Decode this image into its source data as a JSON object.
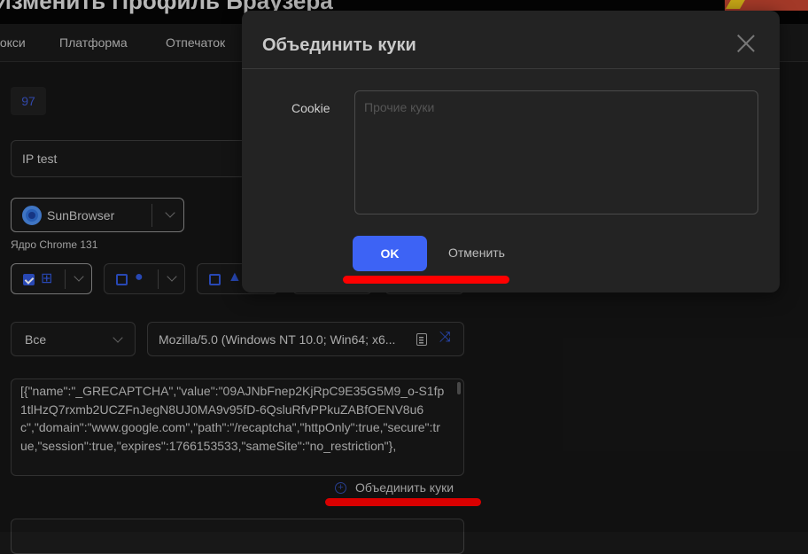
{
  "header": {
    "title": "Изменить Профиль Браузера"
  },
  "tabs": [
    "Прокси",
    "Платформа",
    "Отпечаток"
  ],
  "form": {
    "id_badge": "97",
    "name_value": "IP test",
    "browser": "SunBrowser",
    "kernel": "Ядро Chrome 131",
    "os_options": [
      {
        "name": "windows",
        "checked": true
      },
      {
        "name": "macos",
        "checked": false
      },
      {
        "name": "linux",
        "checked": false
      }
    ],
    "ua_filter": "Все",
    "user_agent": "Mozilla/5.0 (Windows NT 10.0; Win64; x6...",
    "cookies": "[{\"name\":\"_GRECAPTCHA\",\"value\":\"09AJNbFnep2KjRpC9E35G5M9_o-S1fp1tlHzQ7rxmb2UCZFnJegN8UJ0MA9v95fD-6QsluRfvPPkuZABfOENV8u6c\",\"domain\":\"www.google.com\",\"path\":\"/recaptcha\",\"httpOnly\":true,\"secure\":true,\"session\":true,\"expires\":1766153533,\"sameSite\":\"no_restriction\"},",
    "merge_cookies_link": "Объединить куки"
  },
  "modal": {
    "title": "Объединить куки",
    "cookie_label": "Cookie",
    "cookie_placeholder": "Прочие куки",
    "ok_label": "OK",
    "cancel_label": "Отменить"
  },
  "colors": {
    "accent": "#3d63f5",
    "annotation": "#ff0000"
  }
}
